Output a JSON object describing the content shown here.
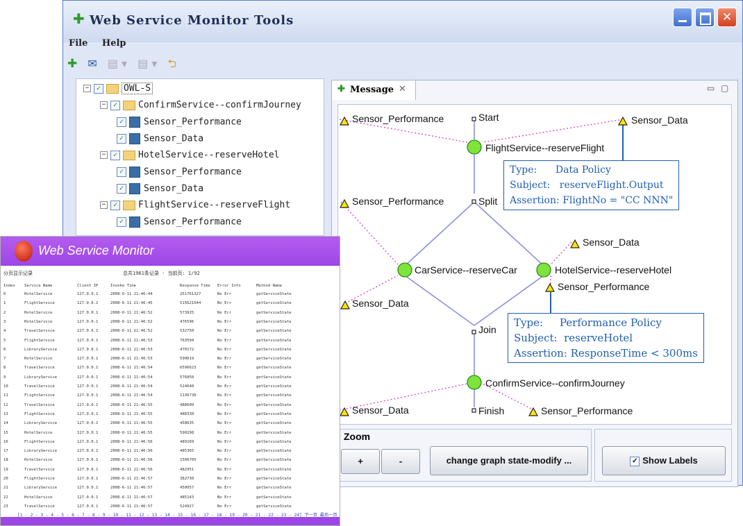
{
  "window": {
    "title": "Web Service Monitor Tools",
    "controls": [
      "minimize",
      "maximize",
      "close"
    ]
  },
  "menu": [
    "File",
    "Help"
  ],
  "toolbar": {
    "icons": [
      "add-icon",
      "mail-icon",
      "doc-icon",
      "doc2-icon",
      "back-icon"
    ]
  },
  "tree": [
    {
      "indent": 0,
      "expander": "⊟",
      "kind": "folder",
      "label": "OWL-S"
    },
    {
      "indent": 1,
      "expander": "⊟",
      "kind": "folder",
      "label": "ConfirmService--confirmJourney"
    },
    {
      "indent": 2,
      "expander": "",
      "kind": "sensor",
      "label": "Sensor_Performance"
    },
    {
      "indent": 2,
      "expander": "",
      "kind": "sensor",
      "label": "Sensor_Data"
    },
    {
      "indent": 1,
      "expander": "⊟",
      "kind": "folder",
      "label": "HotelService--reserveHotel"
    },
    {
      "indent": 2,
      "expander": "",
      "kind": "sensor",
      "label": "Sensor_Performance"
    },
    {
      "indent": 2,
      "expander": "",
      "kind": "sensor",
      "label": "Sensor_Data"
    },
    {
      "indent": 1,
      "expander": "⊟",
      "kind": "folder",
      "label": "FlightService--reserveFlight"
    },
    {
      "indent": 2,
      "expander": "",
      "kind": "sensor",
      "label": "Sensor_Performance"
    }
  ],
  "message_tab": {
    "label": "Message",
    "close": "✕"
  },
  "graph": {
    "labels": {
      "start": "Start",
      "split": "Split",
      "join": "Join",
      "finish": "Finish",
      "flight": "FlightService--reserveFlight",
      "car": "CarService--reserveCar",
      "hotel": "HotelService--reserveHotel",
      "confirm": "ConfirmService--confirmJourney",
      "sp1": "Sensor_Performance",
      "sd1": "Sensor_Data",
      "sp2": "Sensor_Performance",
      "sd2": "Sensor_Data",
      "sd3": "Sensor_Data",
      "sp3": "Sensor_Performance",
      "sd4": "Sensor_Data",
      "sp4": "Sensor_Performance"
    },
    "policy1": {
      "type_key": "Type:",
      "type_val": "Data Policy",
      "subject_key": "Subject:",
      "subject_val": "reserveFlight.Output",
      "assert_key": "Assertion:",
      "assert_val": "FlightNo = \"CC NNN\""
    },
    "policy2": {
      "type_key": "Type:",
      "type_val": "Performance Policy",
      "subject_key": "Subject:",
      "subject_val": "reserveHotel",
      "assert_key": "Assertion:",
      "assert_val": "ResponseTime < 300ms"
    }
  },
  "zoom": {
    "title": "Zoom",
    "plus": "+",
    "minus": "-",
    "change": "change graph state-modify ...",
    "show_labels": "Show Labels",
    "show_labels_checked": true
  },
  "monitor": {
    "title": "Web Service Monitor",
    "subtitle_left": "分页显示记录",
    "subtitle_right": "总共1961条记录 · 当前页: 1/92",
    "columns": [
      "Index",
      "Service Name",
      "Client IP",
      "Invoke Time",
      "Response Time",
      "Error Info",
      "Method Name"
    ],
    "rows": [
      [
        "0",
        "HotelService",
        "127.0.0.1",
        "2008-6-11 21:46:44",
        "251761327",
        "No Err",
        "getServiceState"
      ],
      [
        "1",
        "FlightService",
        "127.0.0.1",
        "2008-6-11 21:46:45",
        "515621044",
        "No Err",
        "getServiceState"
      ],
      [
        "2",
        "HotelService",
        "127.0.0.1",
        "2008-6-11 21:46:52",
        "573925",
        "No Err",
        "getServiceState"
      ],
      [
        "3",
        "HotelService",
        "127.0.0.1",
        "2008-6-11 21:46:52",
        "476596",
        "No Err",
        "getServiceState"
      ],
      [
        "4",
        "TravelService",
        "127.0.0.1",
        "2008-6-11 21:46:52",
        "532750",
        "No Err",
        "getServiceState"
      ],
      [
        "5",
        "FlightService",
        "127.0.0.1",
        "2008-6-11 21:46:53",
        "763504",
        "No Err",
        "getServiceState"
      ],
      [
        "6",
        "LibraryService",
        "127.0.0.1",
        "2008-6-11 21:46:53",
        "470172",
        "No Err",
        "getServiceState"
      ],
      [
        "7",
        "HotelService",
        "127.0.0.1",
        "2008-6-11 21:46:53",
        "590019",
        "No Err",
        "getServiceState"
      ],
      [
        "8",
        "TravelService",
        "127.0.0.1",
        "2008-6-11 21:46:54",
        "6596623",
        "No Err",
        "getServiceState"
      ],
      [
        "9",
        "LibraryService",
        "127.0.0.1",
        "2008-6-11 21:46:54",
        "576850",
        "No Err",
        "getServiceState"
      ],
      [
        "10",
        "TravelService",
        "127.0.0.1",
        "2008-6-11 21:46:54",
        "524640",
        "No Err",
        "getServiceState"
      ],
      [
        "11",
        "FlightService",
        "127.0.0.1",
        "2008-6-11 21:46:54",
        "1136736",
        "No Err",
        "getServiceState"
      ],
      [
        "12",
        "TravelService",
        "127.0.0.1",
        "2008-6-11 21:46:55",
        "488609",
        "No Err",
        "getServiceState"
      ],
      [
        "13",
        "FlightService",
        "127.0.0.1",
        "2008-6-11 21:46:55",
        "488330",
        "No Err",
        "getServiceState"
      ],
      [
        "14",
        "LibraryService",
        "127.0.0.1",
        "2008-6-11 21:46:55",
        "458635",
        "No Err",
        "getServiceState"
      ],
      [
        "15",
        "HotelService",
        "127.0.0.1",
        "2008-6-11 21:46:55",
        "590298",
        "No Err",
        "getServiceState"
      ],
      [
        "16",
        "FlightService",
        "127.0.0.1",
        "2008-6-11 21:46:56",
        "489169",
        "No Err",
        "getServiceState"
      ],
      [
        "17",
        "LibraryService",
        "127.0.0.1",
        "2008-6-11 21:46:56",
        "485365",
        "No Err",
        "getServiceState"
      ],
      [
        "18",
        "HotelService",
        "127.0.0.1",
        "2008-6-11 21:46:56",
        "1506705",
        "No Err",
        "getServiceState"
      ],
      [
        "19",
        "TravelService",
        "127.0.0.1",
        "2008-6-11 21:46:56",
        "482951",
        "No Err",
        "getServiceState"
      ],
      [
        "20",
        "FlightService",
        "127.0.0.1",
        "2008-6-11 21:46:57",
        "382730",
        "No Err",
        "getServiceState"
      ],
      [
        "21",
        "LibraryService",
        "127.0.0.1",
        "2008-6-11 21:46:57",
        "450057",
        "No Err",
        "getServiceState"
      ],
      [
        "22",
        "HotelService",
        "127.0.0.1",
        "2008-6-11 21:46:57",
        "485143",
        "No Err",
        "getServiceState"
      ],
      [
        "23",
        "TravelService",
        "127.0.0.1",
        "2008-6-11 21:46:57",
        "524927",
        "No Err",
        "getServiceState"
      ]
    ],
    "pager": "[1 - 2 - 3 - 4 - 5 - 6 - 7 - 8 - 9 - 10 - 11 - 12 - 13 - 14 - 15 - 16 - 17 - 18 - 19 - 20 - 21 - 22 - 23 - 24] 下一页 最后一页"
  },
  "colors": {
    "accent": "#1f5fb0",
    "node_green": "#7ee33a",
    "sensor_yellow": "#ffe400",
    "monitor_purple": "#9c46e6"
  }
}
